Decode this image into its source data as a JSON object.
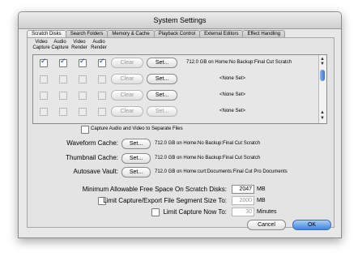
{
  "window": {
    "title": "System Settings"
  },
  "tabs": [
    "Scratch Disks",
    "Search Folders",
    "Memory & Cache",
    "Playback Control",
    "External Editors",
    "Effect Handling"
  ],
  "columns": [
    "Video Capture",
    "Audio Capture",
    "Video Render",
    "Audio Render"
  ],
  "scratch_rows": [
    {
      "video_capture": true,
      "audio_capture": true,
      "video_render": true,
      "audio_render": true,
      "clear_label": "Clear",
      "set_label": "Set...",
      "path": "712.0 GB on  Home:No Backup:Final Cut Scratch"
    },
    {
      "video_capture": false,
      "audio_capture": false,
      "video_render": false,
      "audio_render": false,
      "clear_label": "Clear",
      "set_label": "Set...",
      "path": "<None Set>"
    },
    {
      "video_capture": false,
      "audio_capture": false,
      "video_render": false,
      "audio_render": false,
      "clear_label": "Clear",
      "set_label": "Set...",
      "path": "<None Set>"
    },
    {
      "video_capture": false,
      "audio_capture": false,
      "video_render": false,
      "audio_render": false,
      "clear_label": "Clear",
      "set_label": "Set...",
      "path": "<None Set>"
    }
  ],
  "separate_files_label": "Capture Audio and Video to Separate Files",
  "caches": [
    {
      "label": "Waveform Cache:",
      "set_label": "Set...",
      "path": "712.0 GB on  Home:No Backup:Final Cut Scratch"
    },
    {
      "label": "Thumbnail Cache:",
      "set_label": "Set...",
      "path": "712.0 GB on  Home:No Backup:Final Cut Scratch"
    },
    {
      "label": "Autosave Vault:",
      "set_label": "Set...",
      "path": "712.0 GB on  Home:curt:Documents:Final Cut Pro Documents"
    }
  ],
  "limits": {
    "min_free_label": "Minimum Allowable Free Space On Scratch Disks:",
    "min_free_value": "2047",
    "min_free_unit": "MB",
    "segment_label": "Limit Capture/Export File Segment Size To:",
    "segment_value": "2000",
    "segment_unit": "MB",
    "capture_now_label": "Limit Capture Now To:",
    "capture_now_value": "30",
    "capture_now_unit": "Minutes"
  },
  "footer": {
    "cancel_label": "Cancel",
    "ok_label": "OK"
  },
  "colors": {
    "accent": "#3f86e0",
    "check": "#1a3fa8"
  }
}
